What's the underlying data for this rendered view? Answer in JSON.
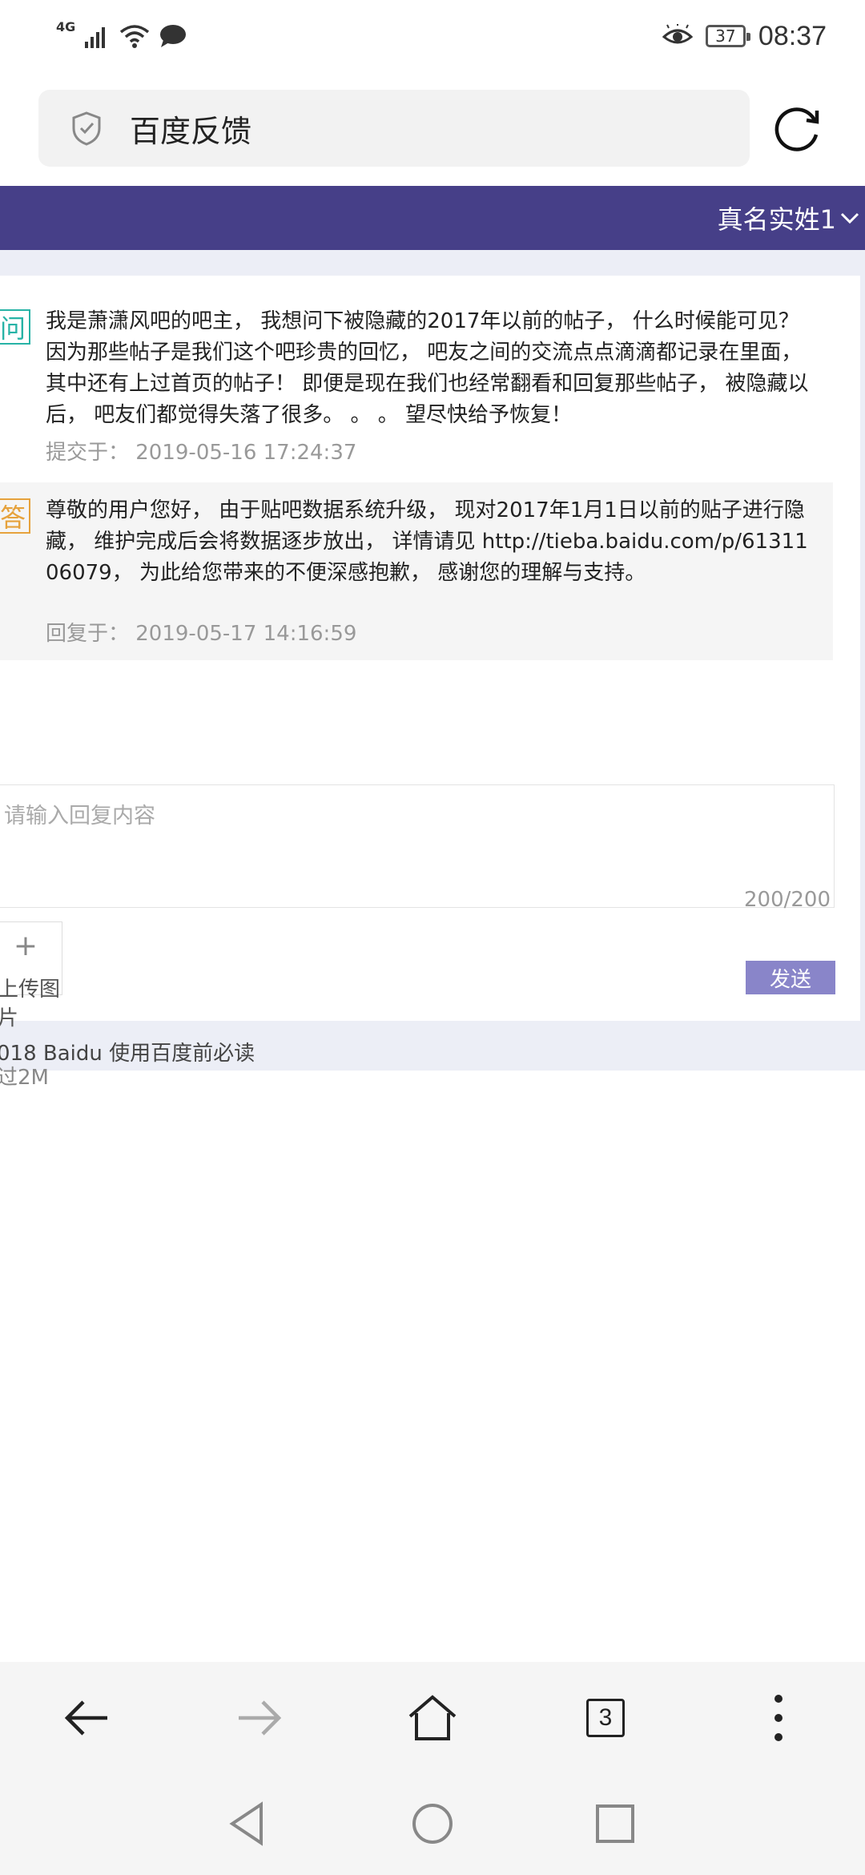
{
  "status_bar": {
    "network": "4G",
    "battery": "37",
    "time": "08:37"
  },
  "browser": {
    "address": "百度反馈"
  },
  "header": {
    "user_name": "真名实姓1"
  },
  "question": {
    "tag": "问",
    "text": "我是萧潇风吧的吧主， 我想问下被隐藏的2017年以前的帖子， 什么时候能可见？ 因为那些帖子是我们这个吧珍贵的回忆， 吧友之间的交流点点滴滴都记录在里面， 其中还有上过首页的帖子！ 即便是现在我们也经常翻看和回复那些帖子， 被隐藏以后， 吧友们都觉得失落了很多。 。 。 望尽快给予恢复！",
    "meta": "提交于： 2019-05-16 17:24:37"
  },
  "answer": {
    "tag": "答",
    "text": "尊敬的用户您好， 由于贴吧数据系统升级， 现对2017年1月1日以前的贴子进行隐藏， 维护完成后会将数据逐步放出， 详情请见 http://tieba.baidu.com/p/6131106079， 为此给您带来的不便深感抱歉， 感谢您的理解与支持。",
    "meta": "回复于： 2019-05-17 14:16:59"
  },
  "reply": {
    "placeholder": "请输入回复内容",
    "counter": "200/200"
  },
  "upload": {
    "plus": "+",
    "label": "上传图片",
    "limit": "过2M"
  },
  "send_label": "发送",
  "footer_text": "018 Baidu 使用百度前必读",
  "nav": {
    "tabs_count": "3"
  }
}
